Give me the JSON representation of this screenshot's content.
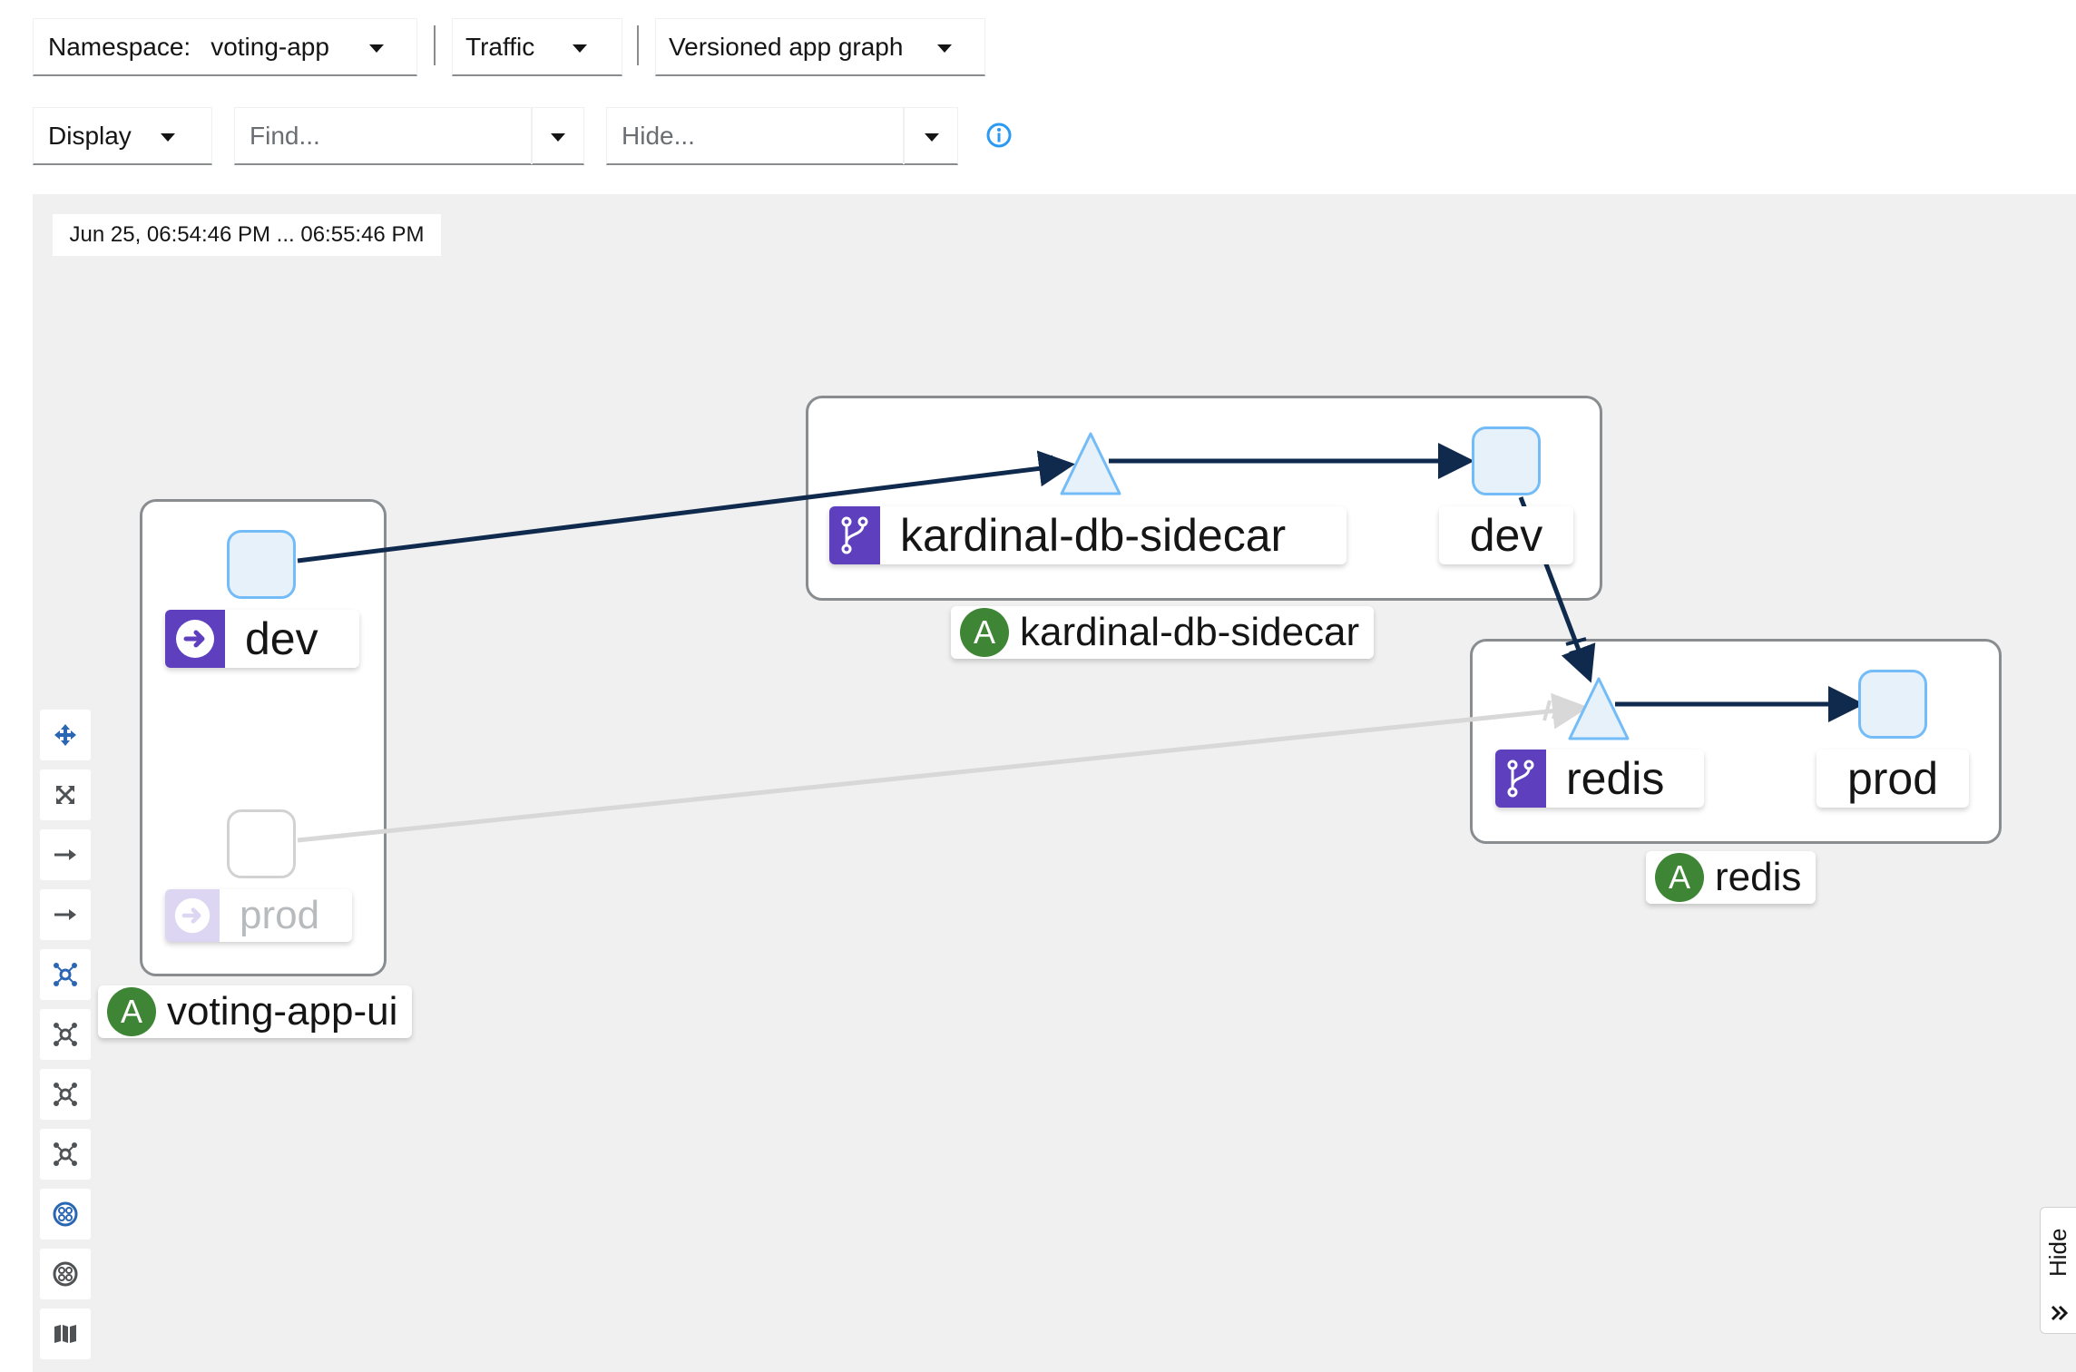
{
  "toolbar": {
    "namespace_label": "Namespace:",
    "namespace_value": "voting-app",
    "traffic_label": "Traffic",
    "graph_type_label": "Versioned app graph",
    "display_label": "Display",
    "find_placeholder": "Find...",
    "hide_placeholder": "Hide..."
  },
  "graph": {
    "time_range": "Jun 25, 06:54:46 PM ... 06:55:46 PM",
    "apps": {
      "voting_app_ui": {
        "name": "voting-app-ui",
        "badge": "A",
        "versions": [
          "dev",
          "prod"
        ]
      },
      "kardinal_db_sidecar": {
        "name": "kardinal-db-sidecar",
        "badge": "A",
        "service": "kardinal-db-sidecar",
        "versions": [
          "dev"
        ]
      },
      "redis": {
        "name": "redis",
        "badge": "A",
        "service": "redis",
        "versions": [
          "prod"
        ]
      }
    }
  },
  "side_panel": {
    "hide_label": "Hide"
  },
  "colors": {
    "edge": "#0f2a4c",
    "edge_faded": "#d8d8d8",
    "node_border": "#73bcf7",
    "node_fill": "#e7f1fa",
    "version_badge": "#5e40be",
    "app_badge": "#3e8635",
    "canvas": "#f0f0f0"
  }
}
